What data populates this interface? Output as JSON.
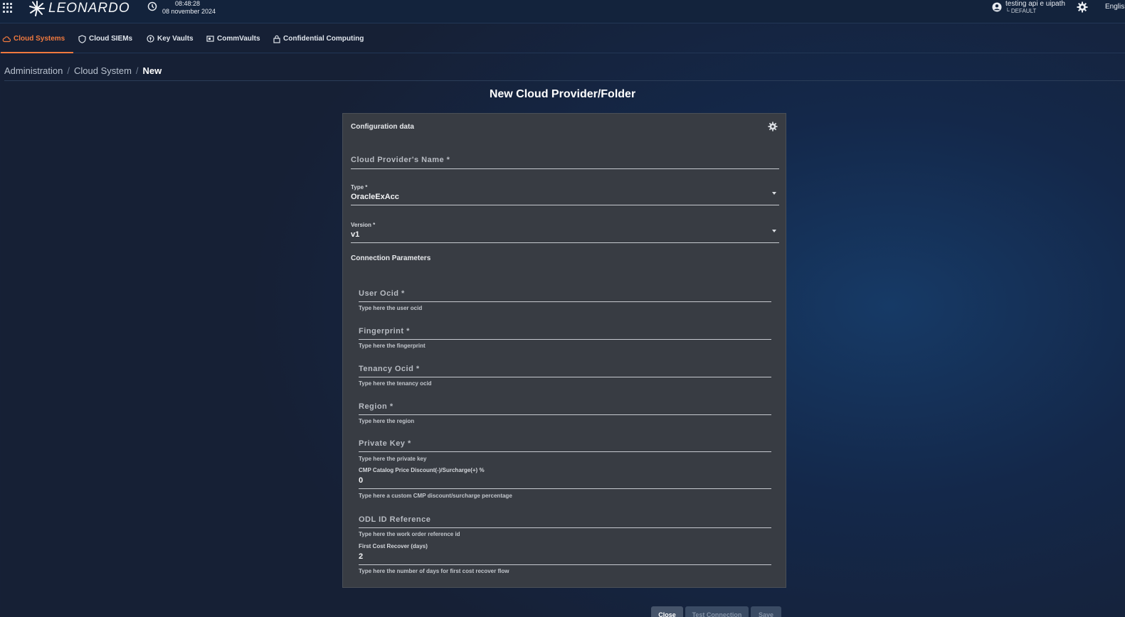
{
  "header": {
    "logo_text": "LEONARDO",
    "time": "08:48:28",
    "date": "08 november 2024",
    "user_name": "testing api e uipath",
    "user_role": "└ DEFAULT",
    "language": "English"
  },
  "tabs": [
    {
      "label": "Cloud Systems",
      "icon": "cloud-icon",
      "active": true
    },
    {
      "label": "Cloud SIEMs",
      "icon": "shield-icon",
      "active": false
    },
    {
      "label": "Key Vaults",
      "icon": "key-vault-icon",
      "active": false
    },
    {
      "label": "CommVaults",
      "icon": "commvault-icon",
      "active": false
    },
    {
      "label": "Confidential Computing",
      "icon": "lock-icon",
      "active": false
    }
  ],
  "breadcrumb": {
    "items": [
      "Administration",
      "Cloud System"
    ],
    "separator": "/",
    "current": "New"
  },
  "page_title": "New Cloud Provider/Folder",
  "card": {
    "header": "Configuration data",
    "name_field": {
      "placeholder": "Cloud Provider's Name *",
      "value": ""
    },
    "type_field": {
      "label": "Type *",
      "value": "OracleExAcc"
    },
    "version_field": {
      "label": "Version *",
      "value": "v1"
    },
    "connection_title": "Connection Parameters",
    "params": [
      {
        "label": "User Ocid *",
        "hint": "Type here the user ocid",
        "value": ""
      },
      {
        "label": "Fingerprint *",
        "hint": "Type here the fingerprint",
        "value": ""
      },
      {
        "label": "Tenancy Ocid *",
        "hint": "Type here the tenancy ocid",
        "value": ""
      },
      {
        "label": "Region *",
        "hint": "Type here the region",
        "value": ""
      },
      {
        "label": "Private Key *",
        "hint": "Type here the private key",
        "value": ""
      },
      {
        "label": "CMP Catalog Price Discount(-)/Surcharge(+) %",
        "hint": "Type here a custom CMP discount/surcharge percentage",
        "value": "0"
      },
      {
        "label": "ODL ID Reference",
        "hint": "Type here the work order reference id",
        "value": ""
      },
      {
        "label": "First Cost Recover (days)",
        "hint": "Type here the number of days for first cost recover flow",
        "value": "2"
      }
    ]
  },
  "buttons": {
    "close": "Close",
    "test_connection": "Test Connection",
    "save": "Save"
  },
  "colors": {
    "accent": "#f0793e",
    "topbar": "#13233c",
    "card": "#383c43"
  }
}
